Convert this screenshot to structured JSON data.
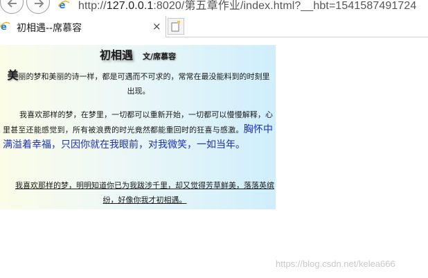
{
  "browser": {
    "url_prefix": "http://",
    "url_host": "127.0.0.1",
    "url_rest": ":8020/第五章作业/index.html?__hbt=1541587491724",
    "tab_title": "初相遇--席慕容",
    "tab_close_glyph": "×",
    "back_icon": "arrow-left-icon",
    "forward_icon": "arrow-right-icon",
    "site_icon": "internet-explorer-icon",
    "new_tab_icon": "new-tab-icon"
  },
  "poem": {
    "title": "初相遇",
    "author": "文/席慕容",
    "p1_first_char": "美",
    "p1_rest": "丽的梦和美丽的诗一样，都是可遇而不可求的，常常在最没能料到的时刻里出现。",
    "p2_normal": "我喜欢那样的梦，在梦里，一切都可以重新开始，一切都可以慢慢解释，心里甚至还能感觉到，所有被浪费的时光竟然都能重回时的狂喜与感激。",
    "p2_highlight": "胸怀中满溢着幸福，只因你就在我眼前，对我微笑，一如当年。",
    "p3": "我喜欢那样的梦，明明知道你已为我跋涉千里，却又觉得芳草鲜美，落落英缤纷，好像你我才初相遇。"
  },
  "colors": {
    "highlight_text": "#1b2fb5",
    "gradient_left": "#fbfde8",
    "gradient_right": "#cfeefc"
  },
  "watermark": "https://blog.csdn.net/kelea666"
}
